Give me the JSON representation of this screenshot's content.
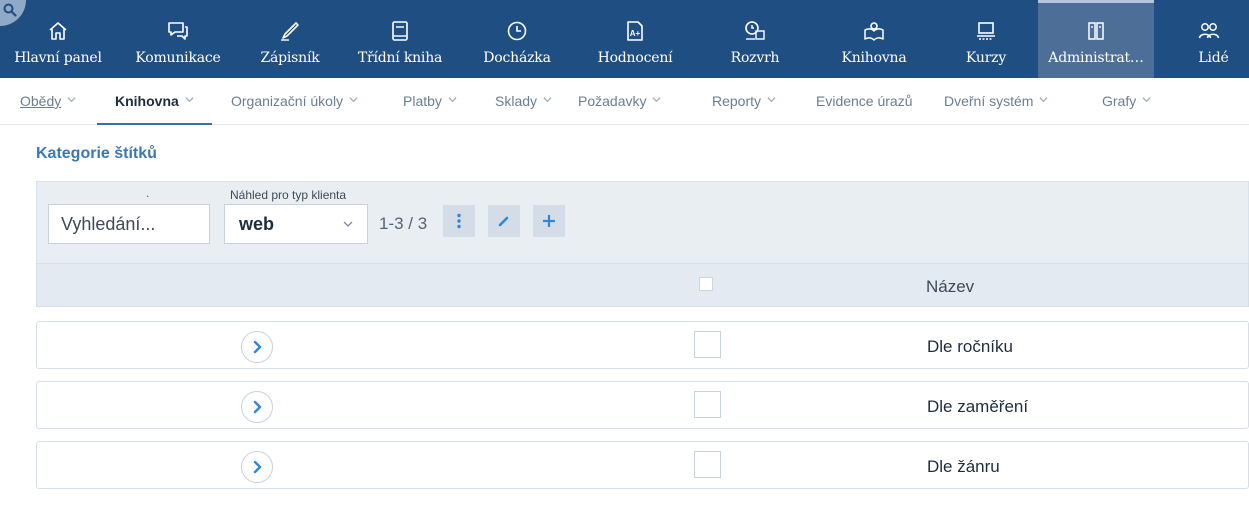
{
  "topnav": {
    "items": [
      {
        "label": "Hlavní panel",
        "icon": "home-icon"
      },
      {
        "label": "Komunikace",
        "icon": "chat-icon"
      },
      {
        "label": "Zápisník",
        "icon": "pen-icon"
      },
      {
        "label": "Třídní kniha",
        "icon": "book-icon"
      },
      {
        "label": "Docházka",
        "icon": "clock-icon"
      },
      {
        "label": "Hodnocení",
        "icon": "grade-icon"
      },
      {
        "label": "Rozvrh",
        "icon": "schedule-icon"
      },
      {
        "label": "Knihovna",
        "icon": "library-icon"
      },
      {
        "label": "Kurzy",
        "icon": "courses-icon"
      },
      {
        "label": "Administrat…",
        "icon": "admin-icon",
        "active": true
      },
      {
        "label": "Lidé",
        "icon": "people-icon"
      }
    ]
  },
  "subnav": {
    "items": [
      {
        "label": "Obědy"
      },
      {
        "label": "Knihovna",
        "active": true
      },
      {
        "label": "Organizační úkoly"
      },
      {
        "label": "Platby"
      },
      {
        "label": "Sklady"
      },
      {
        "label": "Požadavky"
      },
      {
        "label": "Reporty"
      },
      {
        "label": "Evidence úrazů"
      },
      {
        "label": "Dveřní systém"
      },
      {
        "label": "Grafy"
      }
    ]
  },
  "page": {
    "title": "Kategorie štítků"
  },
  "toolbar": {
    "dot": ".",
    "search_placeholder": "Vyhledání...",
    "preview_label": "Náhled pro typ klienta",
    "client_type_value": "web",
    "pager": "1-3 / 3"
  },
  "table": {
    "header_name": "Název",
    "rows": [
      {
        "name": "Dle ročníku"
      },
      {
        "name": "Dle zaměření"
      },
      {
        "name": "Dle žánru"
      }
    ]
  },
  "colors": {
    "topnav_bg": "#1f4e82",
    "topnav_active_bg": "#4d6f97",
    "accent": "#3a78b2"
  }
}
